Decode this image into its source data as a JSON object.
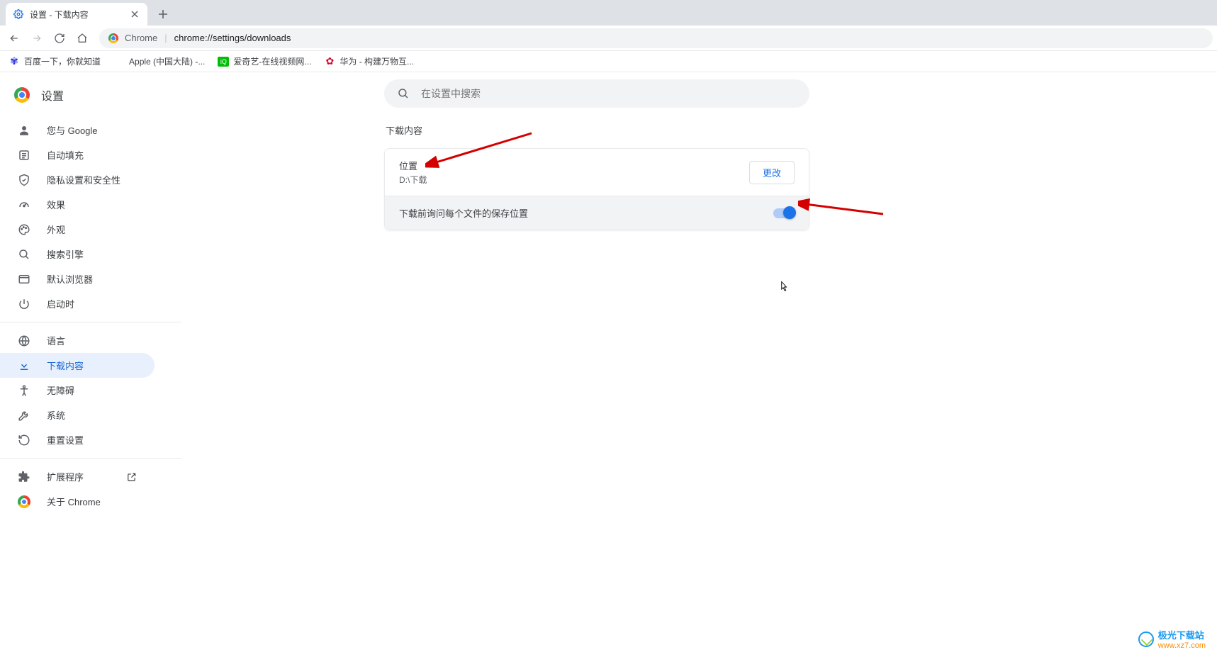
{
  "tab": {
    "title": "设置 - 下载内容"
  },
  "omnibox": {
    "prefix": "Chrome",
    "url": "chrome://settings/downloads"
  },
  "bookmarks": [
    {
      "label": "百度一下，你就知道"
    },
    {
      "label": "Apple (中国大陆) -..."
    },
    {
      "label": "爱奇艺-在线视频网..."
    },
    {
      "label": "华为 - 构建万物互..."
    }
  ],
  "app": {
    "title": "设置"
  },
  "search": {
    "placeholder": "在设置中搜索"
  },
  "sidebar": {
    "groups": [
      [
        {
          "label": "您与 Google",
          "icon": "person"
        },
        {
          "label": "自动填充",
          "icon": "autofill"
        },
        {
          "label": "隐私设置和安全性",
          "icon": "shield"
        },
        {
          "label": "效果",
          "icon": "speedometer"
        },
        {
          "label": "外观",
          "icon": "palette"
        },
        {
          "label": "搜索引擎",
          "icon": "search"
        },
        {
          "label": "默认浏览器",
          "icon": "browser"
        },
        {
          "label": "启动时",
          "icon": "power"
        }
      ],
      [
        {
          "label": "语言",
          "icon": "globe"
        },
        {
          "label": "下载内容",
          "icon": "download",
          "active": true
        },
        {
          "label": "无障碍",
          "icon": "accessibility"
        },
        {
          "label": "系统",
          "icon": "wrench"
        },
        {
          "label": "重置设置",
          "icon": "restore"
        }
      ],
      [
        {
          "label": "扩展程序",
          "icon": "extension",
          "external": true
        },
        {
          "label": "关于 Chrome",
          "icon": "chrome"
        }
      ]
    ]
  },
  "section": {
    "title": "下载内容",
    "location_label": "位置",
    "location_value": "D:\\下载",
    "change_btn": "更改",
    "ask_label": "下载前询问每个文件的保存位置"
  },
  "watermark": {
    "line1": "极光下载站",
    "line2": "www.xz7.com"
  }
}
